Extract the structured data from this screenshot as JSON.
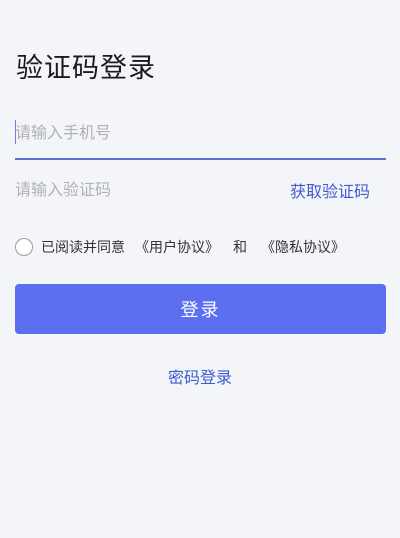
{
  "header": {
    "title": "验证码登录"
  },
  "phone": {
    "placeholder": "请输入手机号",
    "value": ""
  },
  "code": {
    "placeholder": "请输入验证码",
    "value": "",
    "get_code_label": "获取验证码"
  },
  "agreement": {
    "checked": false,
    "prefix": "已阅读并同意",
    "user_agreement": "《用户协议》",
    "and": "和",
    "privacy_agreement": "《隐私协议》"
  },
  "actions": {
    "login_label": "登录",
    "password_login_label": "密码登录"
  },
  "colors": {
    "accent": "#5b6ff0",
    "link": "#3f5bd1",
    "background": "#f4f5f9"
  }
}
